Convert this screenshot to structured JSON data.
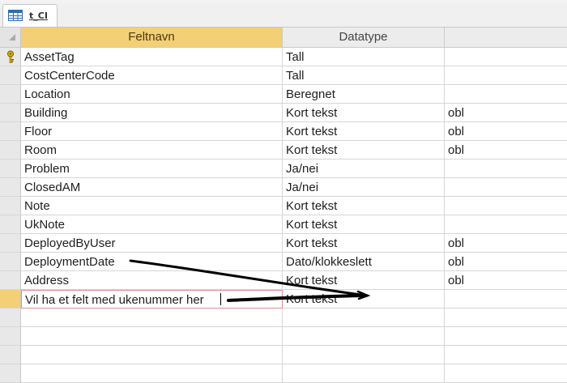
{
  "window": {
    "tab_title": "t_CI"
  },
  "grid": {
    "columns": [
      "Feltnavn",
      "Datatype",
      ""
    ],
    "rows": [
      {
        "name": "AssetTag",
        "type": "Tall",
        "desc": "",
        "primary_key": true
      },
      {
        "name": "CostCenterCode",
        "type": "Tall",
        "desc": ""
      },
      {
        "name": "Location",
        "type": "Beregnet",
        "desc": ""
      },
      {
        "name": "Building",
        "type": "Kort tekst",
        "desc": "obl"
      },
      {
        "name": "Floor",
        "type": "Kort tekst",
        "desc": "obl"
      },
      {
        "name": "Room",
        "type": "Kort tekst",
        "desc": "obl"
      },
      {
        "name": "Problem",
        "type": "Ja/nei",
        "desc": ""
      },
      {
        "name": "ClosedAM",
        "type": "Ja/nei",
        "desc": ""
      },
      {
        "name": "Note",
        "type": "Kort tekst",
        "desc": ""
      },
      {
        "name": "UkNote",
        "type": "Kort tekst",
        "desc": ""
      },
      {
        "name": "DeployedByUser",
        "type": "Kort tekst",
        "desc": "obl"
      },
      {
        "name": "DeploymentDate",
        "type": "Dato/klokkeslett",
        "desc": "obl"
      },
      {
        "name": "Address",
        "type": "Kort tekst",
        "desc": "obl"
      },
      {
        "name": "Vil ha et felt med ukenummer her",
        "type": "Kort tekst",
        "desc": "",
        "active": true
      },
      {
        "name": "",
        "type": "",
        "desc": ""
      },
      {
        "name": "",
        "type": "",
        "desc": ""
      },
      {
        "name": "",
        "type": "",
        "desc": ""
      },
      {
        "name": "",
        "type": "",
        "desc": ""
      }
    ]
  },
  "colors": {
    "selected_header": "#f3cf76",
    "grid_line": "#d6d6d6",
    "annotation_ink": "#000000",
    "active_cell_border": "#e58a9a"
  },
  "icons": {
    "tab": "table-icon",
    "key": "primary-key-icon"
  }
}
